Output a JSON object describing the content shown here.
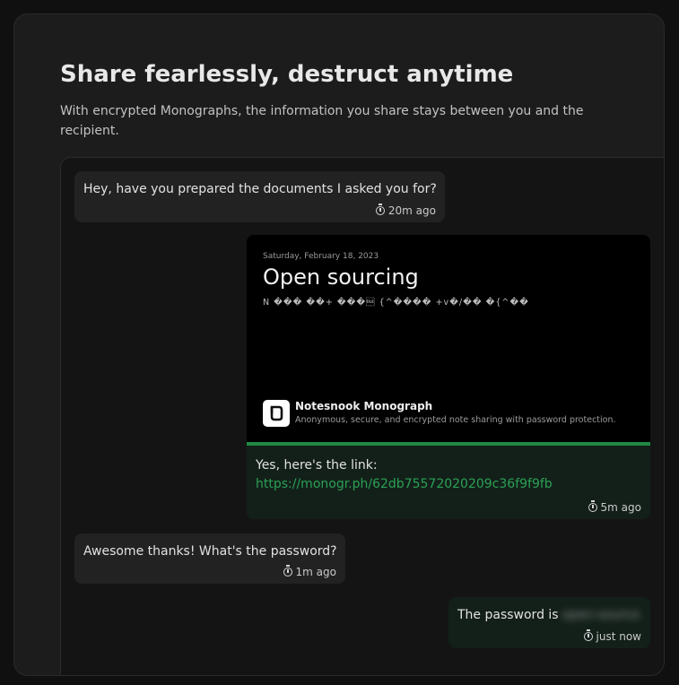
{
  "header": {
    "title": "Share fearlessly, destruct anytime",
    "subtitle": "With encrypted Monographs, the information you share stays between you and the recipient."
  },
  "messages": [
    {
      "text": "Hey, have you prepared the documents I asked you for?",
      "time": "20m ago",
      "direction": "incoming"
    },
    {
      "text": "Yes, here's the link:",
      "link": "https://monogr.ph/62db75572020209c36f9f9fb",
      "time": "5m ago",
      "direction": "outgoing"
    },
    {
      "text": "Awesome thanks! What's the password?",
      "time": "1m ago",
      "direction": "incoming"
    },
    {
      "text": "The password is",
      "secret": "open-source",
      "time": "just now",
      "direction": "outgoing"
    }
  ],
  "preview": {
    "date": "Saturday, February 18, 2023",
    "title": "Open sourcing",
    "body": "N  ���  ��+  ���\u0010  {^����  +v�/��  �{^��",
    "brand": "Notesnook Monograph",
    "tagline": "Anonymous, secure, and encrypted note sharing with password protection."
  },
  "icons": {
    "timer": "timer-icon",
    "logo": "notesnook-logo-icon"
  },
  "colors": {
    "accent": "#2aa154",
    "outgoing_bg": "#13201a",
    "incoming_bg": "#222222"
  }
}
